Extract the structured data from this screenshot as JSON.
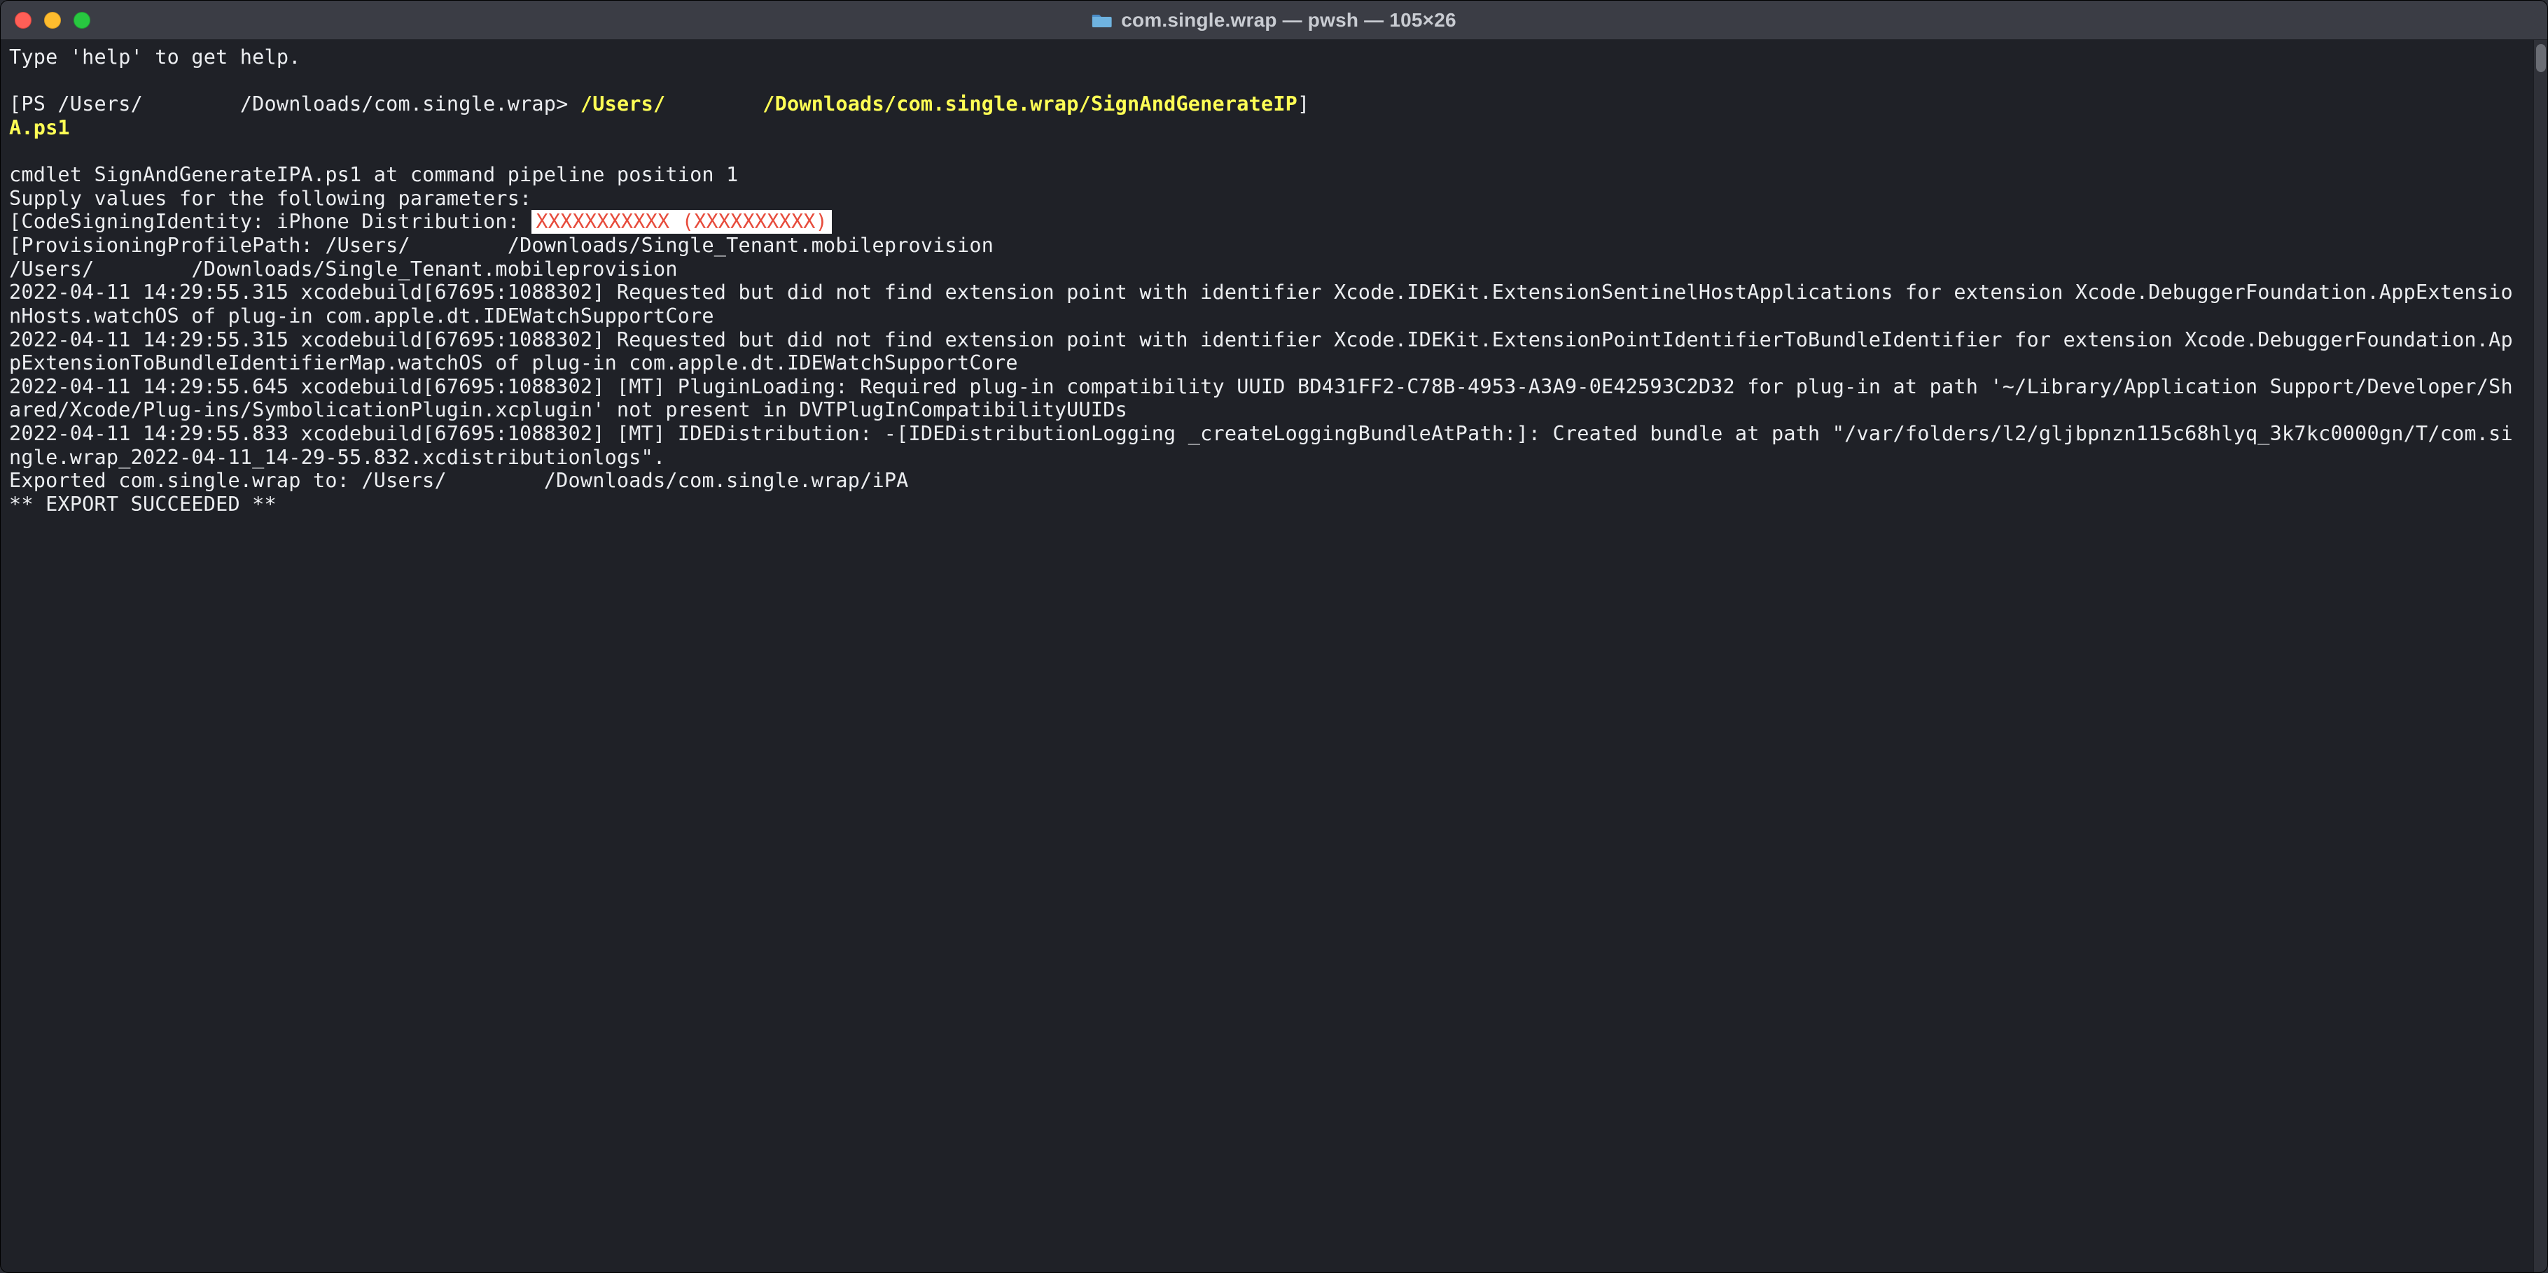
{
  "window": {
    "title": "com.single.wrap — pwsh — 105×26"
  },
  "terminal": {
    "help_line": "Type 'help' to get help.",
    "prompt_prefix": "PS /Users/",
    "prompt_user_redacted": "        ",
    "prompt_path_suffix": "/Downloads/com.single.wrap>",
    "command_prefix": "/Users/",
    "command_user_redacted": "        ",
    "command_path_suffix": "/Downloads/com.single.wrap/SignAndGenerateIP",
    "command_wrap_line": "A.ps1",
    "cmdlet_line": "cmdlet SignAndGenerateIPA.ps1 at command pipeline position 1",
    "supply_line": "Supply values for the following parameters:",
    "codesign_label": "CodeSigningIdentity: iPhone Distribution: ",
    "codesign_redacted": "XXXXXXXXXXX (XXXXXXXXXX)",
    "provprofile_label": "ProvisioningProfilePath: /Users/",
    "provprofile_user_redacted": "        ",
    "provprofile_suffix": "/Downloads/Single_Tenant.mobileprovision",
    "echo_prefix": "/Users/",
    "echo_user_redacted": "        ",
    "echo_suffix": "/Downloads/Single_Tenant.mobileprovision",
    "log1": "2022-04-11 14:29:55.315 xcodebuild[67695:1088302] Requested but did not find extension point with identifier Xcode.IDEKit.ExtensionSentinelHostApplications for extension Xcode.DebuggerFoundation.AppExtensionHosts.watchOS of plug-in com.apple.dt.IDEWatchSupportCore",
    "log2": "2022-04-11 14:29:55.315 xcodebuild[67695:1088302] Requested but did not find extension point with identifier Xcode.IDEKit.ExtensionPointIdentifierToBundleIdentifier for extension Xcode.DebuggerFoundation.AppExtensionToBundleIdentifierMap.watchOS of plug-in com.apple.dt.IDEWatchSupportCore",
    "log3": "2022-04-11 14:29:55.645 xcodebuild[67695:1088302] [MT] PluginLoading: Required plug-in compatibility UUID BD431FF2-C78B-4953-A3A9-0E42593C2D32 for plug-in at path '~/Library/Application Support/Developer/Shared/Xcode/Plug-ins/SymbolicationPlugin.xcplugin' not present in DVTPlugInCompatibilityUUIDs",
    "log4": "2022-04-11 14:29:55.833 xcodebuild[67695:1088302] [MT] IDEDistribution: -[IDEDistributionLogging _createLoggingBundleAtPath:]: Created bundle at path \"/var/folders/l2/gljbpnzn115c68hlyq_3k7kc0000gn/T/com.single.wrap_2022-04-11_14-29-55.832.xcdistributionlogs\".",
    "exported_prefix": "Exported com.single.wrap to: /Users/",
    "exported_user_redacted": "        ",
    "exported_suffix": "/Downloads/com.single.wrap/iPA",
    "success_line": "** EXPORT SUCCEEDED **"
  }
}
